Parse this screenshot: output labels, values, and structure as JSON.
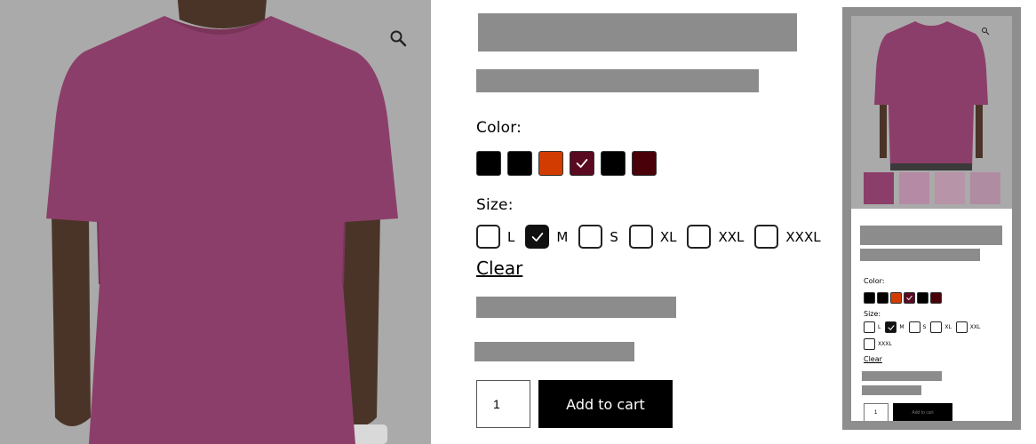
{
  "product": {
    "color_label": "Color:",
    "size_label": "Size:",
    "clear_label": "Clear",
    "quantity_value": "1",
    "add_to_cart_label": "Add to cart"
  },
  "colors": [
    {
      "name": "black",
      "hex": "#000000",
      "selected": false
    },
    {
      "name": "black",
      "hex": "#000000",
      "selected": false
    },
    {
      "name": "orange",
      "hex": "#d23c00",
      "selected": false
    },
    {
      "name": "maroon",
      "hex": "#5a0a20",
      "selected": true
    },
    {
      "name": "black",
      "hex": "#000000",
      "selected": false
    },
    {
      "name": "dark-red",
      "hex": "#4a0008",
      "selected": false
    }
  ],
  "sizes": [
    {
      "label": "L",
      "selected": false
    },
    {
      "label": "M",
      "selected": true
    },
    {
      "label": "S",
      "selected": false
    },
    {
      "label": "XL",
      "selected": false
    },
    {
      "label": "XXL",
      "selected": false
    },
    {
      "label": "XXXL",
      "selected": false
    }
  ],
  "icons": {
    "zoom": "search-icon",
    "check": "checkmark-icon"
  },
  "theme": {
    "image_bg": "#aaaaaa",
    "shirt": "#8c3e6a",
    "redacted": "#8c8c8c",
    "button": "#000000"
  }
}
